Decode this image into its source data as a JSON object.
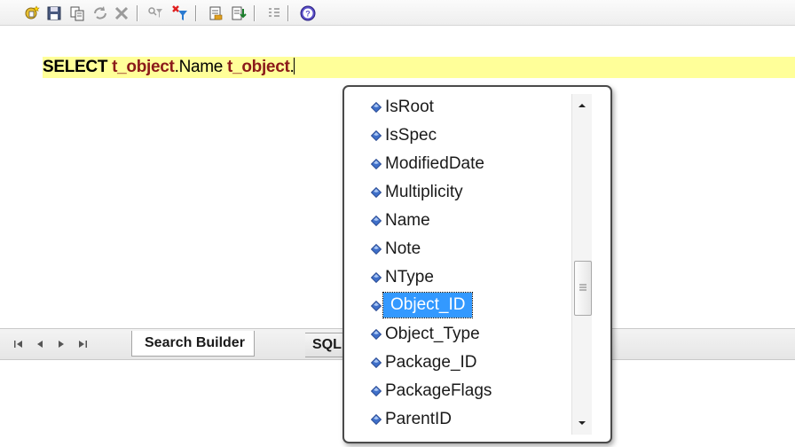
{
  "toolbar": {
    "icons": [
      "new-search-icon",
      "save-icon",
      "copy-icon",
      "refresh-icon",
      "delete-icon",
      "filter-icon",
      "clear-filter-icon",
      "export-icon",
      "import-icon",
      "settings-icon",
      "help-icon"
    ]
  },
  "sql": {
    "keyword": "SELECT ",
    "tbl1": "t_object",
    "col1": ".Name ",
    "tbl2": "t_object",
    "tail": "."
  },
  "tabs": {
    "search_builder": "Search Builder",
    "sql": "SQL"
  },
  "autocomplete": {
    "items": [
      "IsRoot",
      "IsSpec",
      "ModifiedDate",
      "Multiplicity",
      "Name",
      "Note",
      "NType",
      "Object_ID",
      "Object_Type",
      "Package_ID",
      "PackageFlags",
      "ParentID"
    ],
    "selected": "Object_ID"
  },
  "colors": {
    "highlight": "#ffff99",
    "selection": "#3399ff",
    "table_name": "#8b1a1a"
  }
}
